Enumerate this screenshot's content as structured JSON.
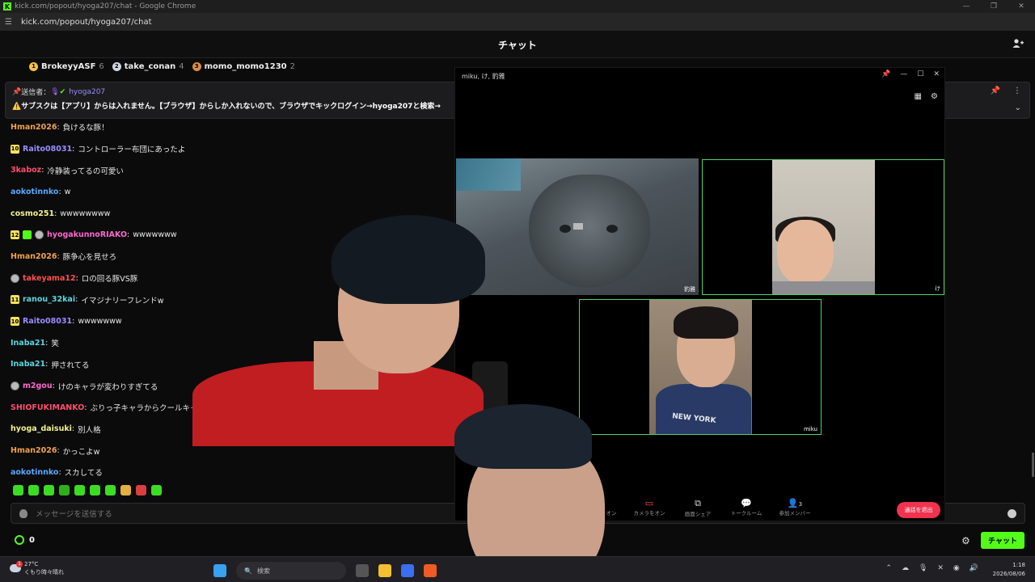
{
  "browser": {
    "title": "kick.com/popout/hyoga207/chat - Google Chrome",
    "url": "kick.com/popout/hyoga207/chat",
    "favicon_letter": "K"
  },
  "chat": {
    "header_title": "チャット",
    "top_supporters": [
      {
        "rank": "1",
        "name": "BrokeyyASF",
        "count": "6",
        "color": "#f5c242"
      },
      {
        "rank": "2",
        "name": "take_conan",
        "count": "4",
        "color": "#cfd6de"
      },
      {
        "rank": "3",
        "name": "momo_momo1230",
        "count": "2",
        "color": "#d98b4a"
      }
    ],
    "pinned": {
      "sent_by_label": "送信者：",
      "sender": "hyoga207",
      "message": "⚠️サブスクは【アプリ】からは入れません。【ブラウザ】からしか入れないので、ブラウザでキックログイン→hyoga207と検索→"
    },
    "messages": [
      {
        "badge": "",
        "user": "Hman2026",
        "user_color": "#f0a24a",
        "text": "負けるな豚！"
      },
      {
        "badge": "10",
        "user": "Raito08031",
        "user_color": "#9b8cff",
        "text": "コントローラー布団にあったよ"
      },
      {
        "badge": "",
        "user": "3kaboz",
        "user_color": "#ff4d6d",
        "text": "冷静装ってるの可愛い"
      },
      {
        "badge": "",
        "user": "aokotinnko",
        "user_color": "#5aa7ff",
        "text": "w"
      },
      {
        "badge": "",
        "user": "cosmo251",
        "user_color": "#f2f28c",
        "text": "wwwwwwww"
      },
      {
        "badge": "12",
        "user": "hyogakunnoRIAKO",
        "user_color": "#ff66cc",
        "text": "wwwwwww"
      },
      {
        "badge": "",
        "user": "Hman2026",
        "user_color": "#f0a24a",
        "text": "豚争心を見せろ"
      },
      {
        "badge": "",
        "user": "takeyama12",
        "user_color": "#ff4d4d",
        "text": "ロの回る豚VS豚"
      },
      {
        "badge": "11",
        "user": "ranou_32kai",
        "user_color": "#5ad7e0",
        "text": "イマジナリーフレンドw"
      },
      {
        "badge": "10",
        "user": "Raito08031",
        "user_color": "#9b8cff",
        "text": "wwwwwww"
      },
      {
        "badge": "",
        "user": "Inaba21",
        "user_color": "#5ad7e0",
        "text": "笑"
      },
      {
        "badge": "",
        "user": "Inaba21",
        "user_color": "#5ad7e0",
        "text": "押されてる"
      },
      {
        "badge": "",
        "user": "m2gou",
        "user_color": "#ff66cc",
        "text": "けのキャラが変わりすぎてる"
      },
      {
        "badge": "",
        "user": "SHIOFUKIMANKO",
        "user_color": "#ff4d6d",
        "text": "ぶりっ子キャラからクールキャラ"
      },
      {
        "badge": "",
        "user": "hyoga_daisuki",
        "user_color": "#f2f28c",
        "text": "別人格"
      },
      {
        "badge": "",
        "user": "Hman2026",
        "user_color": "#f0a24a",
        "text": "かっこよw"
      },
      {
        "badge": "",
        "user": "aokotinnko",
        "user_color": "#5aa7ff",
        "text": "スカしてる"
      }
    ],
    "input_placeholder": "メッセージを送信する",
    "points": "0",
    "send_label": "チャット"
  },
  "call": {
    "window_title": "miku, け, 豹雅",
    "tiles": [
      {
        "label": "豹雅"
      },
      {
        "label": "け"
      },
      {
        "label": "miku"
      }
    ],
    "shirt_text": "NEW YORK",
    "toolbar": [
      {
        "label": "マイクをオン",
        "icon": "mic-off-icon"
      },
      {
        "label": "カメラをオン",
        "icon": "camera-off-icon"
      },
      {
        "label": "画面シェア",
        "icon": "screen-share-icon"
      },
      {
        "label": "トークルーム",
        "icon": "chat-bubble-icon"
      },
      {
        "label": "参加メンバー",
        "icon": "members-icon",
        "count": "3"
      }
    ],
    "leave_label": "通話を退出"
  },
  "taskbar": {
    "temperature": "27°C",
    "weather": "くもり時々晴れ",
    "notification_count": "1",
    "search_placeholder": "検索",
    "time": "1:18",
    "date": "2026/08/06"
  },
  "colors": {
    "kick_green": "#53fc18",
    "call_active_border": "#4fd26a",
    "leave_red": "#f0334e",
    "badge_yellow": "#f5e35a"
  }
}
